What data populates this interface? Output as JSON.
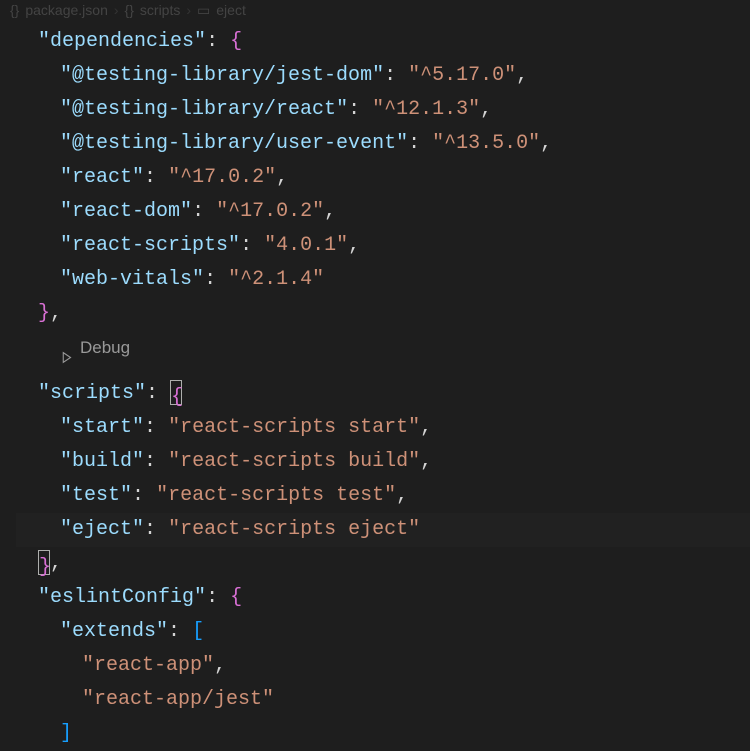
{
  "breadcrumb": {
    "file": "package.json",
    "section": "scripts",
    "item": "eject"
  },
  "codelens": {
    "debug": "Debug"
  },
  "dependencies": {
    "label": "dependencies",
    "items": [
      {
        "k": "@testing-library/jest-dom",
        "v": "^5.17.0"
      },
      {
        "k": "@testing-library/react",
        "v": "^12.1.3"
      },
      {
        "k": "@testing-library/user-event",
        "v": "^13.5.0"
      },
      {
        "k": "react",
        "v": "^17.0.2"
      },
      {
        "k": "react-dom",
        "v": "^17.0.2"
      },
      {
        "k": "react-scripts",
        "v": "4.0.1"
      },
      {
        "k": "web-vitals",
        "v": "^2.1.4"
      }
    ]
  },
  "scripts": {
    "label": "scripts",
    "items": [
      {
        "k": "start",
        "v": "react-scripts start"
      },
      {
        "k": "build",
        "v": "react-scripts build"
      },
      {
        "k": "test",
        "v": "react-scripts test"
      },
      {
        "k": "eject",
        "v": "react-scripts eject"
      }
    ]
  },
  "eslintConfig": {
    "label": "eslintConfig",
    "extends": {
      "label": "extends",
      "items": [
        "react-app",
        "react-app/jest"
      ]
    }
  },
  "q": "\"",
  "colon_sp": ": ",
  "open_brace": "{",
  "close_brace": "}",
  "open_bracket": "[",
  "close_bracket": "]",
  "comma": ","
}
